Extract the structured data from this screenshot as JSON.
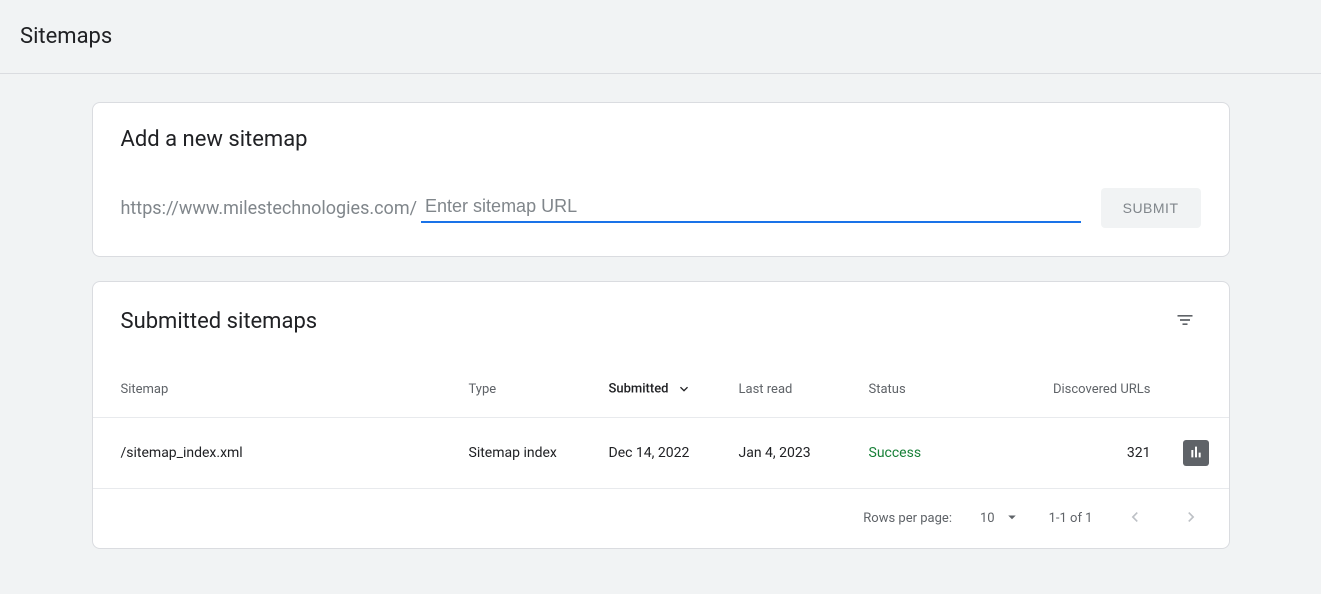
{
  "page": {
    "title": "Sitemaps"
  },
  "add_card": {
    "heading": "Add a new sitemap",
    "url_prefix": "https://www.milestechnologies.com/",
    "placeholder": "Enter sitemap URL",
    "submit_label": "SUBMIT"
  },
  "list_card": {
    "heading": "Submitted sitemaps",
    "columns": {
      "sitemap": "Sitemap",
      "type": "Type",
      "submitted": "Submitted",
      "last_read": "Last read",
      "status": "Status",
      "discovered": "Discovered URLs"
    },
    "rows": [
      {
        "sitemap": "/sitemap_index.xml",
        "type": "Sitemap index",
        "submitted": "Dec 14, 2022",
        "last_read": "Jan 4, 2023",
        "status": "Success",
        "discovered": "321"
      }
    ],
    "pagination": {
      "rows_label": "Rows per page:",
      "rows_value": "10",
      "range": "1-1 of 1"
    }
  }
}
